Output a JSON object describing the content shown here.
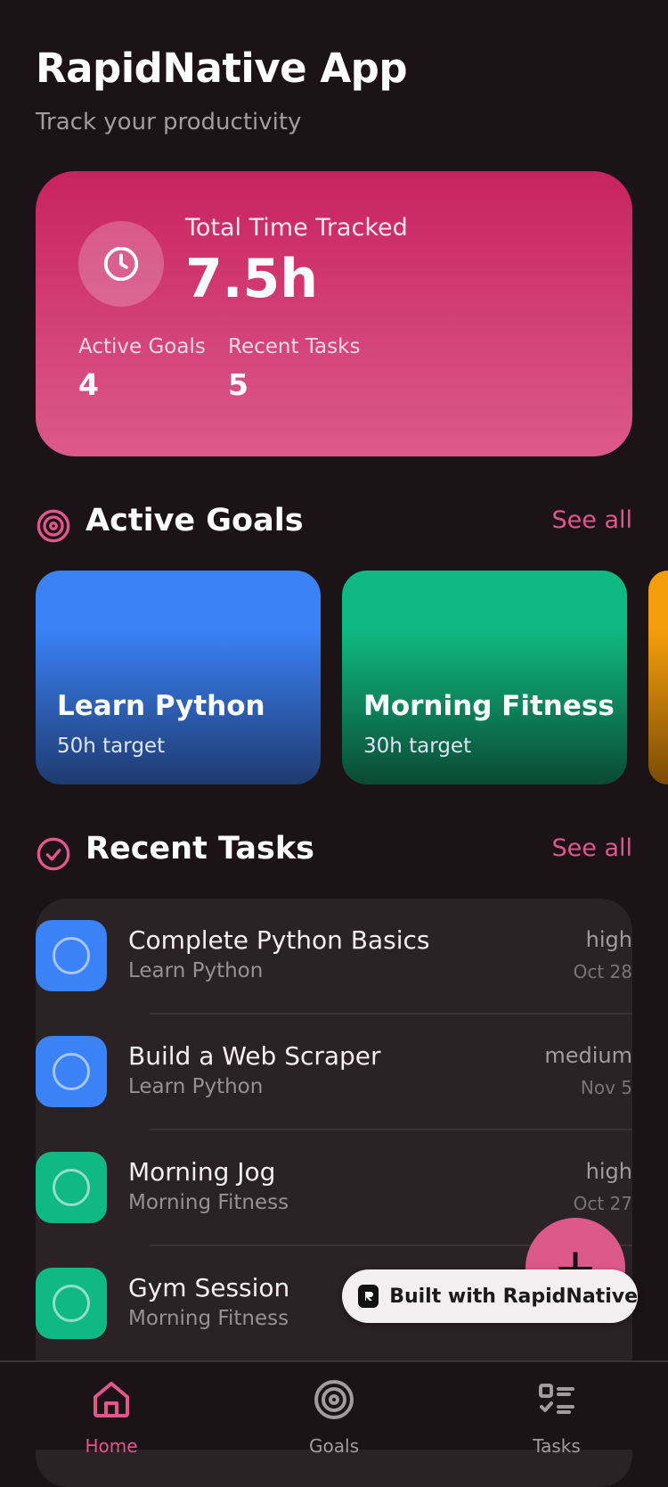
{
  "header": {
    "title": "RapidNative App",
    "subtitle": "Track your productivity"
  },
  "stats": {
    "total_label": "Total Time Tracked",
    "total_value": "7.5h",
    "active_goals_label": "Active Goals",
    "active_goals_value": "4",
    "recent_tasks_label": "Recent Tasks",
    "recent_tasks_value": "5",
    "icon": "clock-icon"
  },
  "goals_section": {
    "title": "Active Goals",
    "see_all": "See all",
    "icon": "target-icon",
    "items": [
      {
        "name": "Learn Python",
        "target": "50h target",
        "color": "#3b82f6"
      },
      {
        "name": "Morning Fitness",
        "target": "30h target",
        "color": "#10b981"
      },
      {
        "name": "",
        "target": "",
        "color": "#f59e0b"
      }
    ]
  },
  "tasks_section": {
    "title": "Recent Tasks",
    "see_all": "See all",
    "icon": "check-circle-icon",
    "items": [
      {
        "title": "Complete Python Basics",
        "goal": "Learn Python",
        "priority": "high",
        "date": "Oct 28",
        "color": "#3b82f6"
      },
      {
        "title": "Build a Web Scraper",
        "goal": "Learn Python",
        "priority": "medium",
        "date": "Nov 5",
        "color": "#3b82f6"
      },
      {
        "title": "Morning Jog",
        "goal": "Morning Fitness",
        "priority": "high",
        "date": "Oct 27",
        "color": "#10b981"
      },
      {
        "title": "Gym Session",
        "goal": "Morning Fitness",
        "priority": "",
        "date": "",
        "color": "#10b981"
      }
    ]
  },
  "fab": {
    "label": "+"
  },
  "badge": {
    "text": "Built with RapidNative"
  },
  "tab_bar": {
    "tabs": [
      {
        "label": "Home",
        "icon": "home-icon",
        "active": true
      },
      {
        "label": "Goals",
        "icon": "target-icon",
        "active": false
      },
      {
        "label": "Tasks",
        "icon": "checklist-icon",
        "active": false
      }
    ]
  },
  "colors": {
    "accent": "#e2578a",
    "background": "#1c1316",
    "card": "#2a2225"
  }
}
